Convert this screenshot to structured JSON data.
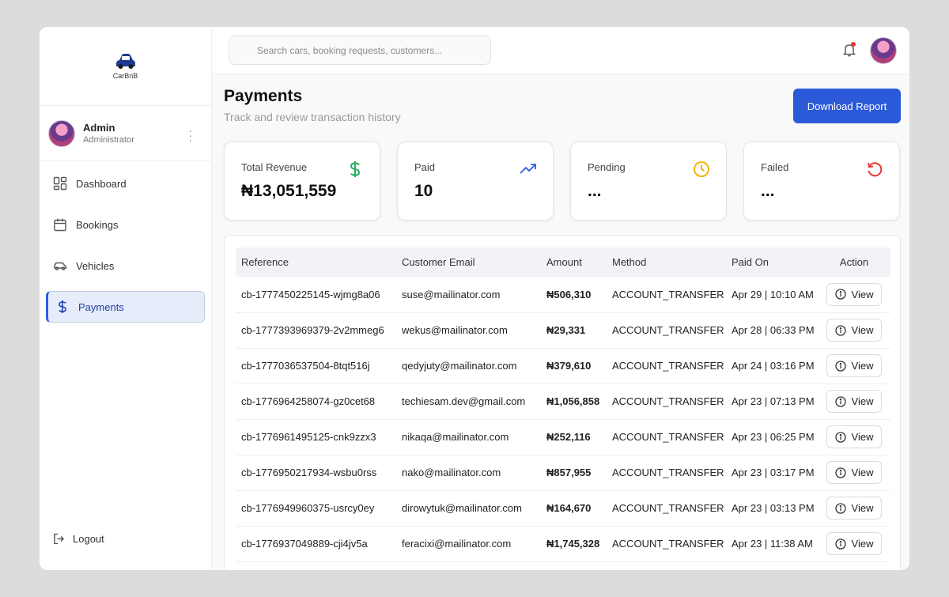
{
  "app": {
    "brand_name": "CarBnB"
  },
  "profile": {
    "name": "Admin",
    "role": "Administrator"
  },
  "sidebar": {
    "items": [
      {
        "label": "Dashboard",
        "icon": "dashboard-grid-icon"
      },
      {
        "label": "Bookings",
        "icon": "calendar-icon"
      },
      {
        "label": "Vehicles",
        "icon": "car-icon"
      },
      {
        "label": "Payments",
        "icon": "dollar-icon",
        "active": true
      }
    ],
    "logout_label": "Logout"
  },
  "search": {
    "placeholder": "Search cars, booking requests, customers...",
    "value": ""
  },
  "header": {
    "title": "Payments",
    "subtitle": "Track and review transaction history",
    "download_label": "Download Report"
  },
  "stats": [
    {
      "label": "Total Revenue",
      "value": "₦13,051,559",
      "icon": "dollar-icon",
      "color": "#22b35e"
    },
    {
      "label": "Paid",
      "value": "10",
      "icon": "trending-up-icon",
      "color": "#2d5be3"
    },
    {
      "label": "Pending",
      "value": "...",
      "icon": "clock-icon",
      "color": "#f5b400"
    },
    {
      "label": "Failed",
      "value": "...",
      "icon": "rotate-ccw-icon",
      "color": "#e53935"
    }
  ],
  "table": {
    "columns": [
      "Reference",
      "Customer Email",
      "Amount",
      "Method",
      "Paid On",
      "Action"
    ],
    "view_label": "View",
    "rows": [
      {
        "reference": "cb-1777450225145-wjmg8a06",
        "email": "suse@mailinator.com",
        "amount": "₦506,310",
        "method": "ACCOUNT_TRANSFER",
        "paid_on": "Apr 29 | 10:10 AM"
      },
      {
        "reference": "cb-1777393969379-2v2mmeg6",
        "email": "wekus@mailinator.com",
        "amount": "₦29,331",
        "method": "ACCOUNT_TRANSFER",
        "paid_on": "Apr 28 | 06:33 PM"
      },
      {
        "reference": "cb-1777036537504-8tqt516j",
        "email": "qedyjuty@mailinator.com",
        "amount": "₦379,610",
        "method": "ACCOUNT_TRANSFER",
        "paid_on": "Apr 24 | 03:16 PM"
      },
      {
        "reference": "cb-1776964258074-gz0cet68",
        "email": "techiesam.dev@gmail.com",
        "amount": "₦1,056,858",
        "method": "ACCOUNT_TRANSFER",
        "paid_on": "Apr 23 | 07:13 PM"
      },
      {
        "reference": "cb-1776961495125-cnk9zzx3",
        "email": "nikaqa@mailinator.com",
        "amount": "₦252,116",
        "method": "ACCOUNT_TRANSFER",
        "paid_on": "Apr 23 | 06:25 PM"
      },
      {
        "reference": "cb-1776950217934-wsbu0rss",
        "email": "nako@mailinator.com",
        "amount": "₦857,955",
        "method": "ACCOUNT_TRANSFER",
        "paid_on": "Apr 23 | 03:17 PM"
      },
      {
        "reference": "cb-1776949960375-usrcy0ey",
        "email": "dirowytuk@mailinator.com",
        "amount": "₦164,670",
        "method": "ACCOUNT_TRANSFER",
        "paid_on": "Apr 23 | 03:13 PM"
      },
      {
        "reference": "cb-1776937049889-cji4jv5a",
        "email": "feracixi@mailinator.com",
        "amount": "₦1,745,328",
        "method": "ACCOUNT_TRANSFER",
        "paid_on": "Apr 23 | 11:38 AM"
      }
    ]
  }
}
